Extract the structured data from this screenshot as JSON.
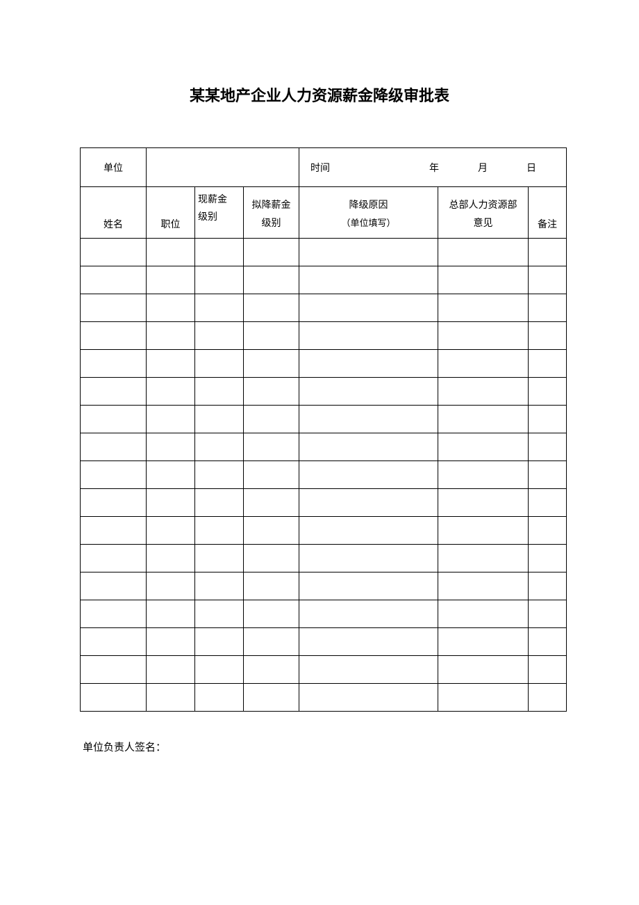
{
  "title": "某某地产企业人力资源薪金降级审批表",
  "header": {
    "unit_label": "单位",
    "time_label": "时间",
    "year": "年",
    "month": "月",
    "day": "日"
  },
  "columns": {
    "name": "姓名",
    "position": "职位",
    "current_salary_line1": "现薪金",
    "current_salary_line2": "级别",
    "proposed_salary_line1": "拟降薪金",
    "proposed_salary_line2": "级别",
    "reason_line1": "降级原因",
    "reason_line2": "（单位填写）",
    "hr_line1": "总部人力资源部",
    "hr_line2": "意见",
    "remark": "备注"
  },
  "signature_label": "单位负责人签名："
}
